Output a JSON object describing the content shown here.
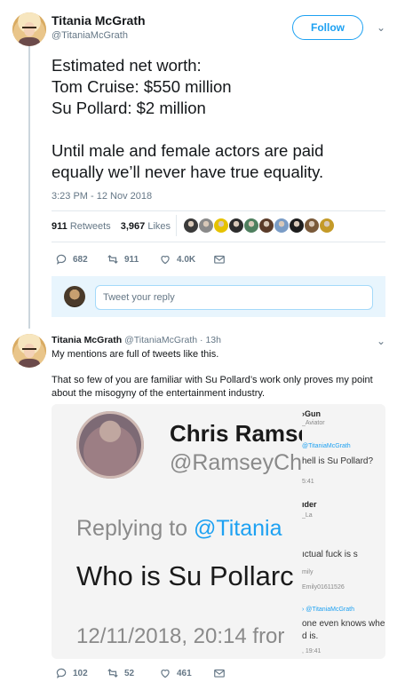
{
  "main_tweet": {
    "author_name": "Titania McGrath",
    "author_handle": "@TitaniaMcGrath",
    "follow_label": "Follow",
    "text_lines": [
      "Estimated net worth:",
      "Tom Cruise: $550 million",
      "Su Pollard: $2 million"
    ],
    "text_lines_2": [
      "Until male and female actors are paid",
      "equally we’ll never have true equality."
    ],
    "timestamp": "3:23 PM - 12 Nov 2018",
    "retweets_count": "911",
    "retweets_label": "Retweets",
    "likes_count": "3,967",
    "likes_label": "Likes",
    "liker_colors": [
      "#3a3a3a",
      "#8a8a8a",
      "#e6c200",
      "#2d2d2d",
      "#4f7f5f",
      "#5b3c2a",
      "#7a9cc6",
      "#1e1e1e",
      "#7a5a3a",
      "#c49a28"
    ],
    "actions": {
      "reply_count": "682",
      "retweet_count": "911",
      "like_count": "4.0K"
    }
  },
  "reply_box": {
    "placeholder": "Tweet your reply"
  },
  "second_tweet": {
    "author_name": "Titania McGrath",
    "author_handle": "@TitaniaMcGrath",
    "time": "· 13h",
    "text_1": "My mentions are full of tweets like this.",
    "text_2": "That so few of you are familiar with Su Pollard’s work only proves my point about the misogyny of the entertainment industry.",
    "actions": {
      "reply_count": "102",
      "retweet_count": "52",
      "like_count": "461"
    },
    "embedded_image": {
      "name": "Chris Ramse",
      "handle": "@RamseyCh",
      "replying_prefix": "Replying to ",
      "replying_handle": "@Titania",
      "question": "Who is Su Pollarc",
      "date": "12/11/2018, 20:14 fror",
      "side_lines": [
        "›Gun",
        "_Aviator",
        "@TitaniaMcGrath",
        "hell is Su Pollard?",
        "5:41",
        "ıder",
        "_La",
        "ıctual fuck is s",
        "mily",
        "Emily01611526",
        "› @TitaniaMcGrath",
        "one even knows whe",
        "d is.",
        ", 19:41"
      ]
    }
  }
}
